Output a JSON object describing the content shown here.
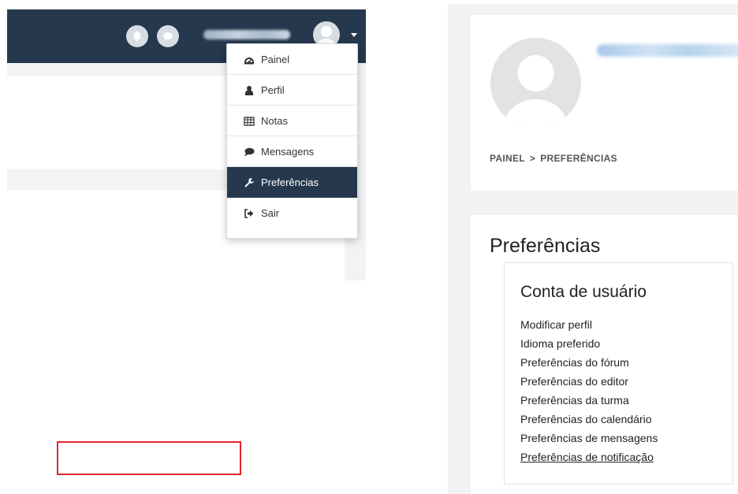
{
  "dropdown": {
    "items": [
      {
        "label": "Painel",
        "icon": "dashboard-icon"
      },
      {
        "label": "Perfil",
        "icon": "user-icon"
      },
      {
        "label": "Notas",
        "icon": "table-icon"
      },
      {
        "label": "Mensagens",
        "icon": "speech-bubble-icon"
      },
      {
        "label": "Preferências",
        "icon": "wrench-icon",
        "active": true
      },
      {
        "label": "Sair",
        "icon": "sign-out-icon"
      }
    ]
  },
  "header": {
    "breadcrumb": [
      "PAINEL",
      ">",
      "PREFERÊNCIAS"
    ]
  },
  "main": {
    "title": "Preferências",
    "section": {
      "title": "Conta de usuário",
      "links": [
        "Modificar perfil",
        "Idioma preferido",
        "Preferências do fórum",
        "Preferências do editor",
        "Preferências da turma",
        "Preferências do calendário",
        "Preferências de mensagens",
        "Preferências de notificação"
      ]
    }
  },
  "colors": {
    "navbar": "#25384e",
    "active_item": "#25384e",
    "highlight_box": "#e5252a",
    "page_bg": "#f2f2f2"
  }
}
